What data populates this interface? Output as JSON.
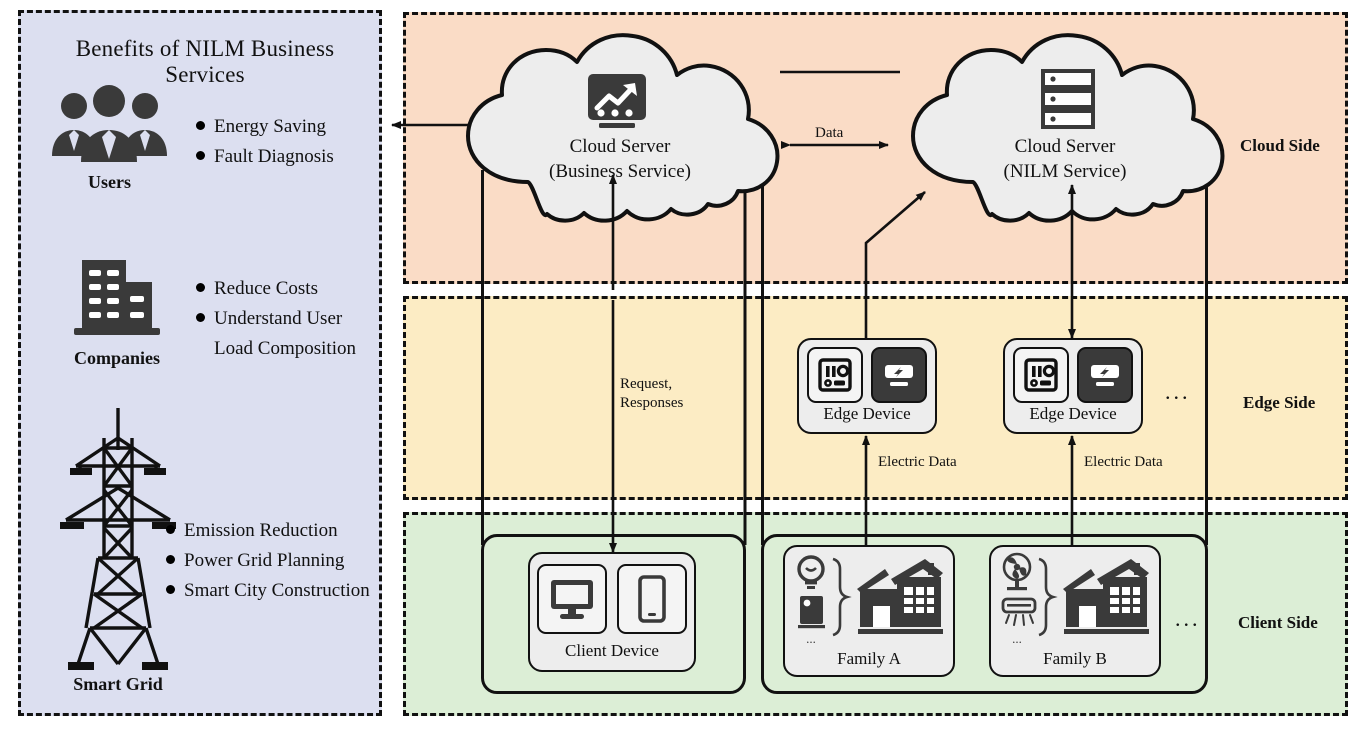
{
  "sidebar": {
    "title": "Benefits of NILM Business Services",
    "groups": [
      {
        "caption": "Users",
        "icon": "users-icon",
        "bullets": [
          "Energy Saving",
          "Fault Diagnosis"
        ],
        "continuation": ""
      },
      {
        "caption": "Companies",
        "icon": "office-building-icon",
        "bullets": [
          "Reduce Costs",
          "Understand User"
        ],
        "continuation": "Load Composition"
      },
      {
        "caption": "Smart Grid",
        "icon": "transmission-tower-icon",
        "bullets": [
          "Emission Reduction",
          "Power Grid Planning",
          "Smart City Construction"
        ],
        "continuation": ""
      }
    ]
  },
  "panels": [
    {
      "key": "cloud",
      "label": "Cloud Side",
      "color": "#fadcc6"
    },
    {
      "key": "edge",
      "label": "Edge Side",
      "color": "#fcecc4"
    },
    {
      "key": "client",
      "label": "Client Side",
      "color": "#dceed6"
    }
  ],
  "nodes": {
    "cloud_business": {
      "line1": "Cloud Server",
      "line2": "(Business Service)",
      "icon": "analytics-chart-icon"
    },
    "cloud_nilm": {
      "line1": "Cloud Server",
      "line2": "(NILM Service)",
      "icon": "server-rack-icon"
    },
    "edge_device_a": {
      "label": "Edge Device",
      "icons": [
        "meter-panel-icon",
        "power-device-icon"
      ]
    },
    "edge_device_b": {
      "label": "Edge Device",
      "icons": [
        "meter-panel-icon",
        "power-device-icon"
      ]
    },
    "client_device": {
      "label": "Client Device",
      "icons": [
        "monitor-icon",
        "smartphone-icon"
      ]
    },
    "family_a": {
      "label": "Family A",
      "icons": [
        "lightbulb-icon",
        "appliance-icon"
      ],
      "house": "house-icon",
      "more": "..."
    },
    "family_b": {
      "label": "Family B",
      "icons": [
        "fan-icon",
        "air-conditioner-icon"
      ],
      "house": "house-icon",
      "more": "..."
    }
  },
  "edges": {
    "data": "Data",
    "request_responses_line1": "Request,",
    "request_responses_line2": "Responses",
    "electric_data_a": "Electric Data",
    "electric_data_b": "Electric Data"
  },
  "ellipsis": {
    "edge": "...",
    "client": "...",
    "family_more": "..."
  },
  "colors": {
    "cloud_side": "#fadcc6",
    "edge_side": "#fcecc4",
    "client_side": "#dceed6",
    "sidebar": "#dcdff0",
    "ink": "#111111"
  }
}
